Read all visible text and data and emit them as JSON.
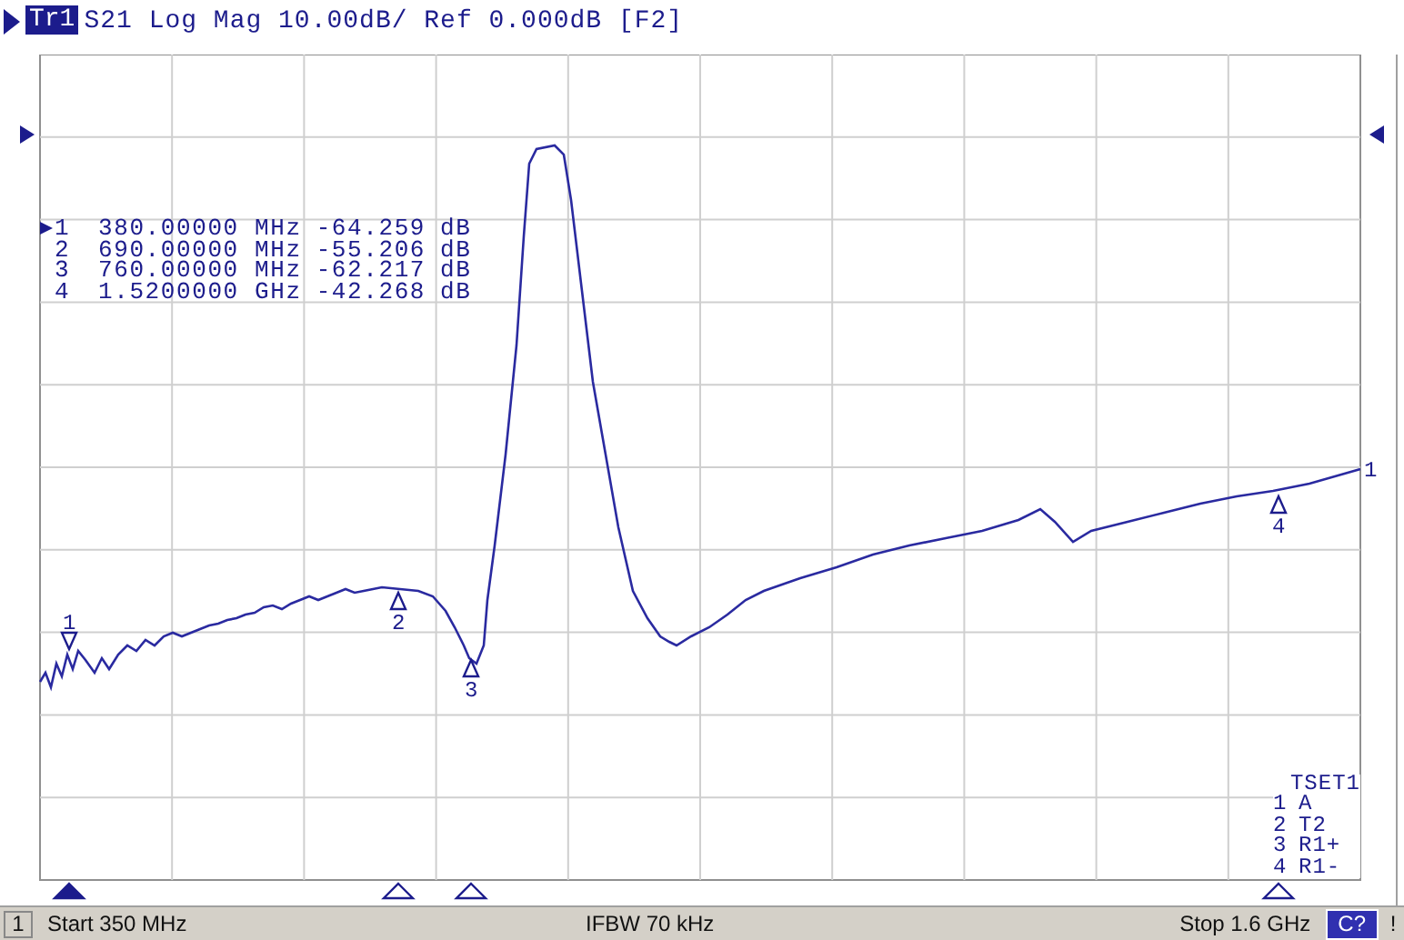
{
  "trace_header": {
    "badge": "Tr1",
    "text": "S21 Log Mag 10.00dB/ Ref 0.000dB [F2]"
  },
  "markers": [
    {
      "label": "1",
      "frequency": "380.00000 MHz",
      "value": "-64.259 dB",
      "active": true,
      "trace_label": "1"
    },
    {
      "label": "2",
      "frequency": "690.00000 MHz",
      "value": "-55.206 dB",
      "active": false,
      "trace_label": "2"
    },
    {
      "label": "3",
      "frequency": "760.00000 MHz",
      "value": "-62.217 dB",
      "active": false,
      "trace_label": "3"
    },
    {
      "label": "4",
      "frequency": "1.5200000 GHz",
      "value": "-42.268 dB",
      "active": false,
      "trace_label": "4"
    }
  ],
  "trace_end_label": "1",
  "tset": {
    "title": "TSET1",
    "rows": [
      {
        "index": "1",
        "name": "A"
      },
      {
        "index": "2",
        "name": "T2"
      },
      {
        "index": "3",
        "name": "R1+"
      },
      {
        "index": "4",
        "name": "R1-"
      }
    ]
  },
  "status_bar": {
    "channel": "1",
    "start": "Start 350 MHz",
    "ifbw": "IFBW 70 kHz",
    "stop": "Stop 1.6 GHz",
    "calibration": "C?",
    "alert": "!"
  }
}
